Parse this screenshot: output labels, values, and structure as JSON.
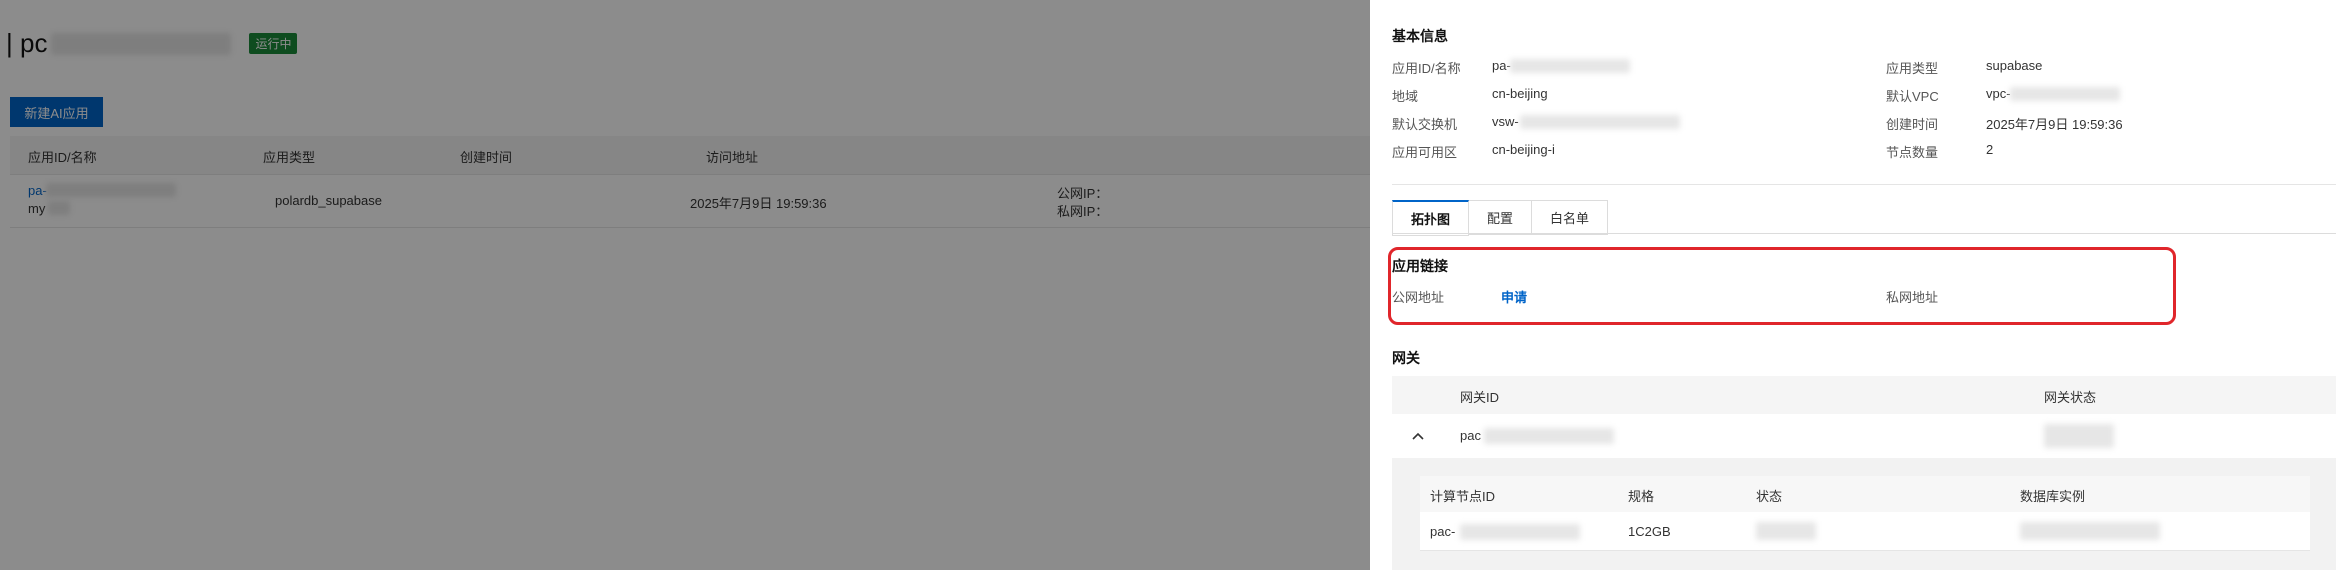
{
  "background": {
    "app_title_prefix": "| pc",
    "status": "运行中",
    "new_app_button": "新建AI应用",
    "table": {
      "headers": [
        "应用ID/名称",
        "应用类型",
        "创建时间",
        "访问地址"
      ],
      "row": {
        "id_prefix": "pa-",
        "name_prefix": "my",
        "type": "polardb_supabase",
        "created": "2025年7月9日 19:59:36",
        "public_ip_label": "公网IP：",
        "private_ip_label": "私网IP："
      }
    }
  },
  "drawer": {
    "basic_info_title": "基本信息",
    "left_fields": [
      {
        "label": "应用ID/名称",
        "value": "pa-"
      },
      {
        "label": "地域",
        "value": "cn-beijing"
      },
      {
        "label": "默认交换机",
        "value": "vsw-"
      },
      {
        "label": "应用可用区",
        "value": "cn-beijing-i"
      }
    ],
    "right_fields": [
      {
        "label": "应用类型",
        "value": "supabase"
      },
      {
        "label": "默认VPC",
        "value": "vpc-"
      },
      {
        "label": "创建时间",
        "value": "2025年7月9日 19:59:36"
      },
      {
        "label": "节点数量",
        "value": "2"
      }
    ],
    "tabs": [
      "拓扑图",
      "配置",
      "白名单"
    ],
    "app_link": {
      "title": "应用链接",
      "public_label": "公网地址",
      "apply_link": "申请",
      "private_label": "私网地址"
    },
    "gateway": {
      "title": "网关",
      "headers": [
        "网关ID",
        "网关状态"
      ],
      "row_id_prefix": "pac",
      "nodes": {
        "headers": [
          "计算节点ID",
          "规格",
          "状态",
          "数据库实例"
        ],
        "row": {
          "id_prefix": "pac-",
          "spec": "1C2GB"
        }
      }
    }
  },
  "colors": {
    "primary": "#0064c8",
    "status_green": "#1a8a3a",
    "highlight_red": "#e0262b"
  }
}
